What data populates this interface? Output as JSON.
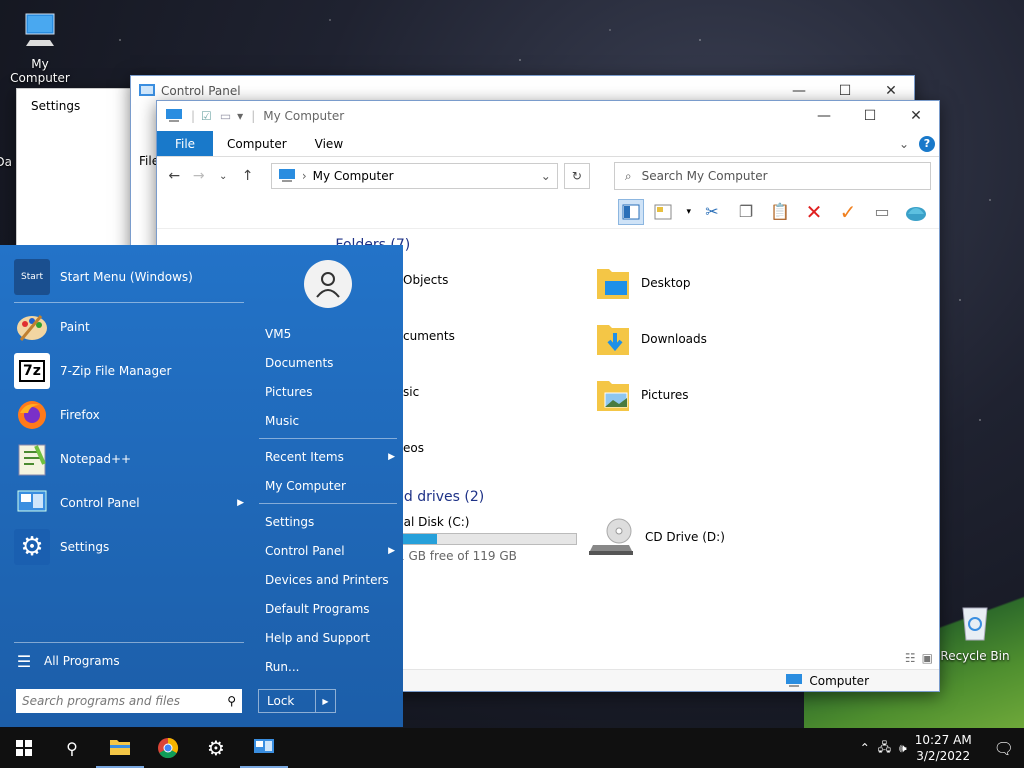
{
  "desktop": {
    "my_computer": "My Computer",
    "recycle_bin": "Recycle Bin",
    "partial_icon_label": "Da"
  },
  "settings_window": {
    "title": "Settings"
  },
  "control_panel_window": {
    "title": "Control Panel",
    "menu_fragment": "File"
  },
  "explorer": {
    "title": "My Computer",
    "tabs": [
      "File",
      "Computer",
      "View"
    ],
    "address": "My Computer",
    "search_placeholder": "Search My Computer",
    "folders_header": "Folders (7)",
    "folders": {
      "objects": "Objects",
      "desktop": "Desktop",
      "documents": "cuments",
      "downloads": "Downloads",
      "music": "sic",
      "pictures": "Pictures",
      "videos": "eos"
    },
    "drives_header": "nd drives (2)",
    "local_disk": "cal Disk (C:)",
    "local_disk_free": "1 GB free of 119 GB",
    "local_disk_fill_pct": 22,
    "cd_drive": "CD Drive (D:)",
    "status": "Computer"
  },
  "start_menu": {
    "left_items": [
      {
        "label": "Start Menu (Windows)"
      },
      {
        "label": "Paint"
      },
      {
        "label": "7-Zip File Manager"
      },
      {
        "label": "Firefox"
      },
      {
        "label": "Notepad++"
      },
      {
        "label": "Control Panel"
      },
      {
        "label": "Settings"
      }
    ],
    "all_programs": "All Programs",
    "search_placeholder": "Search programs and files",
    "right_items": [
      "VM5",
      "Documents",
      "Pictures",
      "Music",
      "Recent Items",
      "My Computer",
      "Settings",
      "Control Panel",
      "Devices and Printers",
      "Default Programs",
      "Help and Support",
      "Run..."
    ],
    "lock": "Lock",
    "start_icon_text": "Start"
  },
  "taskbar": {
    "time": "10:27 AM",
    "date": "3/2/2022"
  },
  "colors": {
    "start_blue": "#1e63b4",
    "ribbon_blue": "#1979ca",
    "group_header": "#1e3287"
  }
}
